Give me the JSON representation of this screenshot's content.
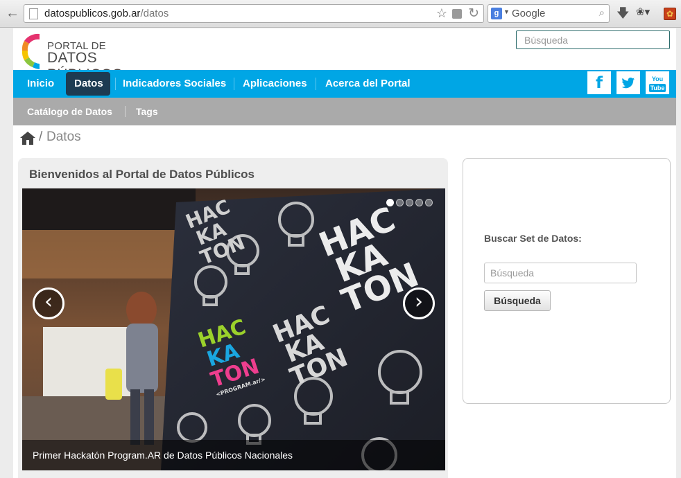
{
  "browser": {
    "url_domain": "datospublicos.gob.ar",
    "url_path": "/datos",
    "search_engine": "Google"
  },
  "site": {
    "logo_line1": "PORTAL DE",
    "logo_line2": "DATOS PÚBLICOS",
    "search_placeholder": "Búsqueda"
  },
  "nav": {
    "items": [
      {
        "label": "Inicio"
      },
      {
        "label": "Datos",
        "active": true
      },
      {
        "label": "Indicadores Sociales"
      },
      {
        "label": "Aplicaciones"
      },
      {
        "label": "Acerca del Portal"
      }
    ],
    "social": {
      "facebook": "f",
      "youtube_top": "You",
      "youtube_bottom": "Tube"
    }
  },
  "subnav": {
    "items": [
      {
        "label": "Catálogo de Datos"
      },
      {
        "label": "Tags"
      }
    ]
  },
  "breadcrumb": {
    "separator": "/",
    "current": "Datos"
  },
  "welcome": {
    "title": "Bienvenidos al Portal de Datos Públicos",
    "carousel": {
      "caption": "Primer Hackatón Program.AR de Datos Públicos Nacionales",
      "slide_count": 5,
      "active_index": 0,
      "banner_words": [
        "HAC",
        "KA",
        "TON"
      ],
      "banner_tag": "<PROGRAM.ar/>",
      "prev_icon": "‹",
      "next_icon": "›"
    }
  },
  "sidebar_search": {
    "label": "Buscar Set de Datos:",
    "placeholder": "Búsqueda",
    "button_label": "Búsqueda"
  },
  "colors": {
    "nav_bg": "#00a6e5",
    "nav_active_bg": "#1d3b52",
    "subnav_bg": "#aaaaaa"
  }
}
